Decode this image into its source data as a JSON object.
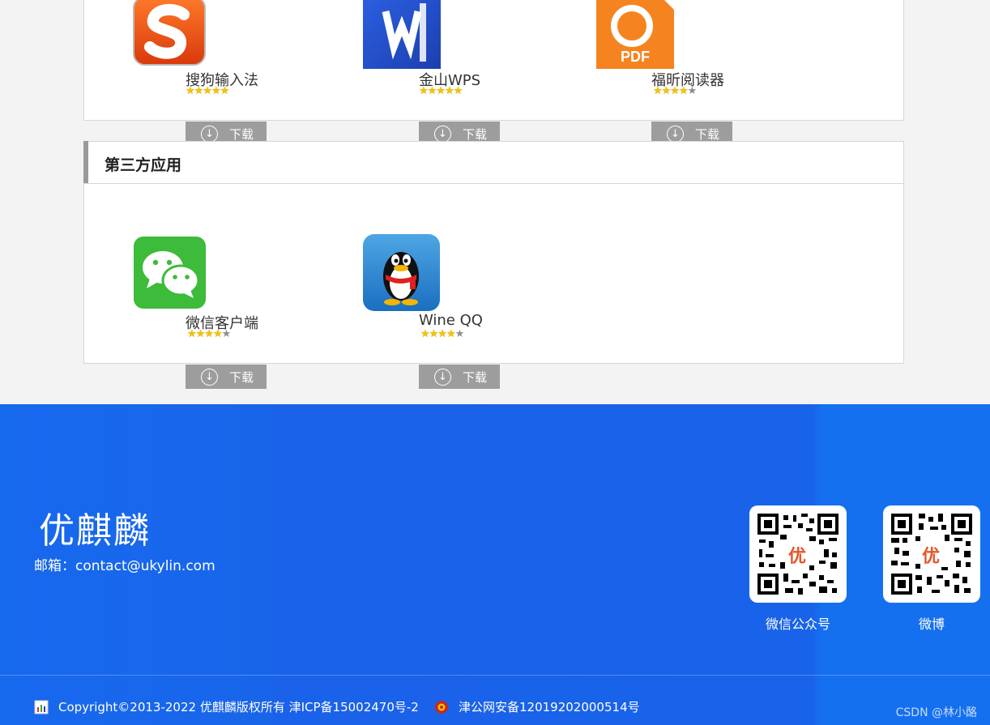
{
  "sections": {
    "third_party_title": "第三方应用"
  },
  "apps_top": [
    {
      "name": "搜狗输入法",
      "rating": 5,
      "download_label": "下载",
      "icon": "sogou-icon"
    },
    {
      "name": "金山WPS",
      "rating": 5,
      "download_label": "下载",
      "icon": "wps-icon"
    },
    {
      "name": "福昕阅读器",
      "rating": 4,
      "download_label": "下载",
      "icon": "foxit-pdf-icon"
    }
  ],
  "apps_third_party": [
    {
      "name": "微信客户端",
      "rating": 4,
      "download_label": "下载",
      "icon": "wechat-icon"
    },
    {
      "name": "Wine QQ",
      "rating": 4,
      "download_label": "下载",
      "icon": "qq-icon"
    }
  ],
  "footer": {
    "brand": "优麒麟",
    "email": "邮箱：contact@ukylin.com",
    "qr_wechat_label": "微信公众号",
    "qr_weibo_label": "微博",
    "qr_center_glyph": "优",
    "copyright": "Copyright©2013-2022 优麒麟版权所有 津ICP备15002470号-2",
    "police": "津公网安备12019202000514号",
    "watermark": "CSDN @林小酪"
  },
  "colors": {
    "footer_blue": "#1865ea",
    "download_gray": "#9d9d9d",
    "star_gold": "#f2c20c"
  }
}
